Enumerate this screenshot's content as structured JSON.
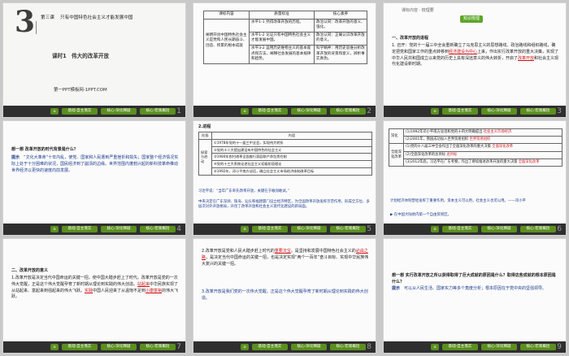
{
  "footer": {
    "home": "⌂",
    "pill_a": "基础·自主落实",
    "pill_b": "核心·深化释疑",
    "pill_c": "核心·宏观概括"
  },
  "slide1": {
    "num": "1",
    "big_digit": "3",
    "lesson_label": "第三课",
    "lesson_title": "只有中国特色社会主义才能发展中国",
    "period": "课时1",
    "period_title": "伟大的改革开放",
    "watermark": "第一PPT模板网-1PPT.COM"
  },
  "slide2": {
    "num": "2",
    "headers": [
      "课标内容",
      "质量标准",
      "核心素养"
    ],
    "left": "阐明开创中国特色社会主义是党和人民长期奋斗、创造、积累的根本成就",
    "rows": [
      {
        "q": "水平1-1 然得改革开放的历程。",
        "c": "政治认同：改革开放的意义、强化。"
      },
      {
        "q": "水平1-2 论证只有中国特色社会主义才能发展中国。",
        "c": "政治认同：正确认识改革开放的意义。"
      },
      {
        "q": "水平3-2 运用历史唯物主义的基本观点和方法，阐释社会发展的基本规律和趋势。",
        "c": "科学精神：用历史思维分析改革开放的背景和意义，辨析事实真伪。"
      }
    ]
  },
  "slide3": {
    "num": "3",
    "tag": "课标内容 · 梳理要",
    "btn": "知识梳理",
    "head": "一、改革开放的进程",
    "body1": "1. 召开：党的十一届三中全会重新确立了马克思主义的思想路线、政治路线和组织路线，确定把党和国家工作的重点转移到",
    "red1": "经济建设为中心",
    "body2": "上来，作出实行改革开放的重大决策，实现了中华人民共和国成立以来党的历史上具有深远意义的伟大转折，开启了",
    "red2": "改革开放",
    "body3": "和社会主义现代化建设新时期。"
  },
  "slide4": {
    "num": "4",
    "q": "想一想 改革开放的时代背景是什么？",
    "a_label": "提示",
    "a": "“文化大革命”十年内乱，使党、国家和人民遭到严重挫折和损失；国家整个经济情况实际上处于十分困难的状况，国民经济到了崩溃的边缘。世界范围内蓬勃兴起的新科技革命推动世界经济以更快的速度向前发展。"
  },
  "slide5": {
    "num": "5",
    "title": "2.进程",
    "headers": [
      "阶段",
      "内容"
    ],
    "stage": "探索与启动",
    "rows": [
      "①1978年党的十一届三中全会，实现伟大转折",
      "②党的十二大提出建设有中国特色的社会主义",
      "③1984年农村改革全面推行家庭联产承包责任制",
      "④党的十三大系统论述社会主义初级阶段理论",
      "⑤1992年，邓小平南方谈话，确立社会主义市场经济体制改革目标"
    ],
    "note1": "习近平说：“当年广东率先改革开放，关键在于敢闯敢试。”",
    "note2": "中央决定在广东深圳、珠海、汕头和福建厦门设立经济特区，为全国改革开放发挥示范作用，形成全方位、多层次对外开放格局，开创了改革开放和社会主义现代化建设的新局面。"
  },
  "slide6": {
    "num": "6",
    "rows": [
      {
        "stage": "深化",
        "items": [
          "(1)1992年邓小平南方谈话和党的十四大明确提出",
          "(2)2001年，我国成功加入世界贸易组织"
        ],
        "red": [
          "社会主义市场经济",
          "世界贸易组织"
        ]
      },
      {
        "stage": "全面深化改革",
        "items": [
          "(1)党的十八届三中全会作出了全面深化改革的重大决策",
          "(2)全面深化改革的总目标",
          "(3)2012年底，习近平在广东考察，作出了继续推进改革开放的重大决策"
        ],
        "red": [
          "全面深化改革",
          "总目标",
          "全面深化改革"
        ]
      }
    ],
    "note": "计划经济体制曾经发挥了重要作用，资本主义可以用，社会主义也可以用。——邓小平",
    "tail": "▶ 在中国大陆地内第一个自由贸易区。"
  },
  "slide7": {
    "num": "7",
    "head": "二、改革开放的意义",
    "p1": "1.改革开放是决定当代中国命运的关键一招，使中国大踏步赶上了时代。改革开放是党的一次伟大觉醒，正是这个伟大觉醒孕育了新时期从理论到实践的伟大创造。",
    "red1": "站起来",
    "p2": "中华民族实现了从站起来、富起来到强起来的伟大飞跃。",
    "red2": "实践",
    "p3": "中国人民迎来了从温饱不足到",
    "red3": "小康富裕",
    "p4": "的伟大飞跃。"
  },
  "slide8": {
    "num": "8",
    "p1": "2.改革开放是党和人民大踏步赶上时代的",
    "red1": "重要法宝",
    "p2": "，是坚持和发展中国特色社会主义的",
    "red2": "必由之路",
    "p3": "，是决定当代中国命运的关键一招，也是决定实现“两个一百年”奋斗目标、实现中华民族伟大复兴的关键一招。",
    "red3": "两个一百年",
    "p4": "3.改革开放是我们党的一次伟大觉醒，正是这个伟大觉醒孕育了新时期从理论到实践的伟大创造。"
  },
  "slide9": {
    "num": "9",
    "q": "想一想 实行改革开放之所以获得取得了巨大成就的原因是什么？取得这些成就的根本原因是什么？",
    "a_label": "提示",
    "a": "可以从人民生活、国家实力等多个角度分析；根本原因在于党中央的坚强领导。"
  }
}
